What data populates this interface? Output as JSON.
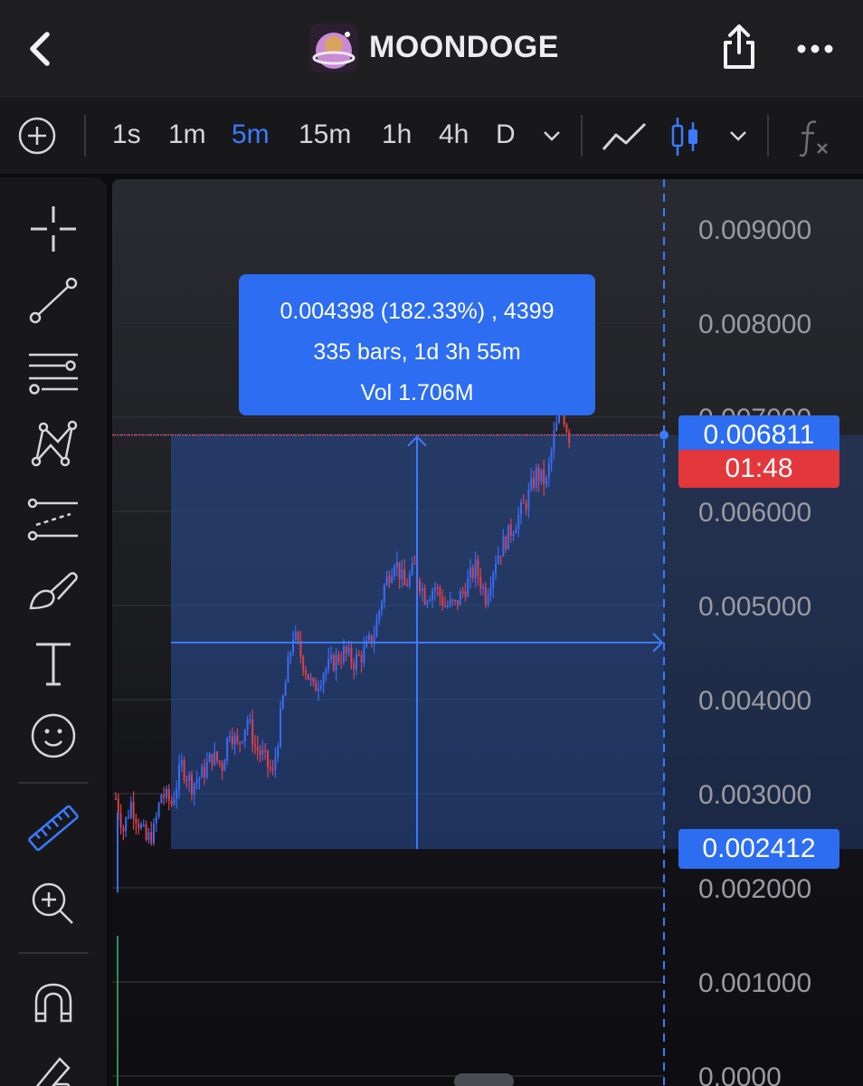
{
  "header": {
    "token_name": "MOONDOGE"
  },
  "toolbar": {
    "timeframes": [
      "1s",
      "1m",
      "5m",
      "15m",
      "1h",
      "4h",
      "D"
    ],
    "active_timeframe": "5m",
    "icons": [
      "add-circle-icon",
      "chevron-down-icon",
      "line-chart-icon",
      "candlestick-icon",
      "chevron-down-icon",
      "fx-icon"
    ]
  },
  "drawing_tools": [
    "crosshair-icon",
    "trend-line-icon",
    "horizontal-lines-icon",
    "pattern-icon",
    "forecast-icon",
    "brush-icon",
    "text-icon",
    "emoji-icon",
    "ruler-icon",
    "zoom-in-icon",
    "magnet-icon",
    "lock-pencil-icon"
  ],
  "colors": {
    "accent": "#2c6df2",
    "bull": "#3b6cf5",
    "bear": "#e0404a",
    "measure_fill": "#2a4f9a"
  },
  "measure_tooltip": {
    "line1": "0.004398 (182.33%) , 4399",
    "line2": "335 bars, 1d 3h 55m",
    "line3": "Vol 1.706M"
  },
  "price_tags": {
    "top": "0.006811",
    "countdown": "01:48",
    "bottom": "0.002412"
  },
  "chart_data": {
    "type": "candlestick",
    "y_axis_ticks": [
      "0.0000",
      "0.001000",
      "0.002000",
      "0.003000",
      "0.004000",
      "0.005000",
      "0.006000",
      "0.007000",
      "0.008000",
      "0.009000"
    ],
    "ylim": [
      0,
      0.0095
    ],
    "measure": {
      "start_price": 0.002412,
      "end_price": 0.006811,
      "change": 0.004398,
      "change_pct": 182.33,
      "bars": 335,
      "duration": "1d 3h 55m",
      "volume": "1.706M"
    },
    "price_path": [
      [
        0,
        0.00295
      ],
      [
        3,
        0.00262
      ],
      [
        6,
        0.0029
      ],
      [
        9,
        0.0027
      ],
      [
        12,
        0.0025
      ],
      [
        15,
        0.0026
      ],
      [
        18,
        0.003
      ],
      [
        22,
        0.0029
      ],
      [
        26,
        0.0033
      ],
      [
        30,
        0.0031
      ],
      [
        34,
        0.0032
      ],
      [
        38,
        0.0034
      ],
      [
        42,
        0.0033
      ],
      [
        45,
        0.0037
      ],
      [
        48,
        0.0035
      ],
      [
        52,
        0.0038
      ],
      [
        55,
        0.0035
      ],
      [
        58,
        0.0034
      ],
      [
        62,
        0.0032
      ],
      [
        66,
        0.004
      ],
      [
        70,
        0.0047
      ],
      [
        74,
        0.0044
      ],
      [
        78,
        0.0041
      ],
      [
        82,
        0.0043
      ],
      [
        86,
        0.0044
      ],
      [
        90,
        0.0045
      ],
      [
        94,
        0.0044
      ],
      [
        98,
        0.0045
      ],
      [
        102,
        0.0047
      ],
      [
        106,
        0.0052
      ],
      [
        110,
        0.0055
      ],
      [
        114,
        0.0052
      ],
      [
        118,
        0.0054
      ],
      [
        122,
        0.0051
      ],
      [
        126,
        0.0052
      ],
      [
        130,
        0.005
      ],
      [
        134,
        0.005
      ],
      [
        138,
        0.0052
      ],
      [
        142,
        0.0054
      ],
      [
        146,
        0.0051
      ],
      [
        150,
        0.0055
      ],
      [
        154,
        0.0057
      ],
      [
        158,
        0.0059
      ],
      [
        162,
        0.0061
      ],
      [
        166,
        0.0064
      ],
      [
        170,
        0.0063
      ],
      [
        173,
        0.0068
      ],
      [
        176,
        0.0071
      ],
      [
        179,
        0.0068
      ]
    ]
  }
}
